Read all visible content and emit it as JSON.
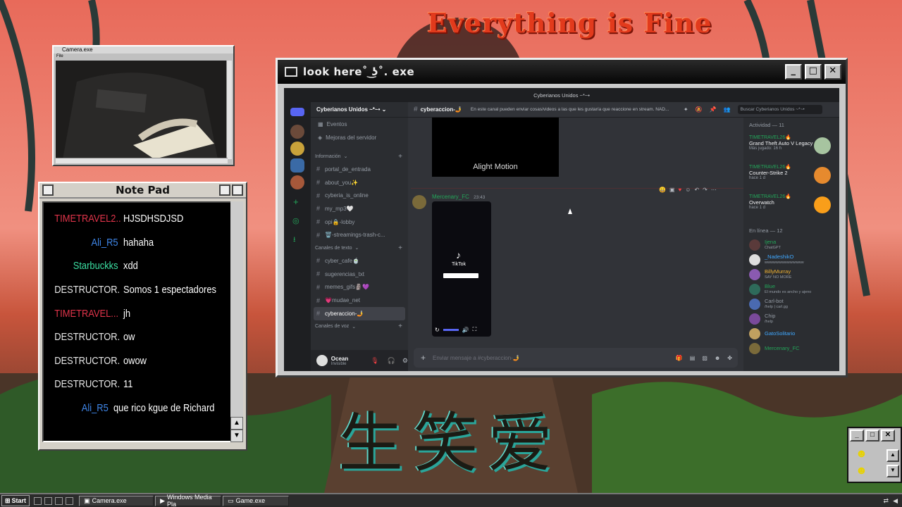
{
  "wallpaper": {
    "headline": "Everything is Fine",
    "kanji": "生笑爱"
  },
  "camera_window": {
    "title": "Camera.exe",
    "menu": "File"
  },
  "notepad": {
    "title": "Note Pad",
    "messages": [
      {
        "user": "TIMETRAVEL2...",
        "text": "HJSDHSDJSD",
        "color": "#e0344a"
      },
      {
        "user": "Ali_R5",
        "text": "hahaha",
        "color": "#3f86e8"
      },
      {
        "user": "Starbuckks",
        "text": "xdd",
        "color": "#3ce0a3"
      },
      {
        "user": "DESTRUCTOR...",
        "text": "Somos 1 espectadores",
        "color": "#e8e8e8"
      },
      {
        "user": "TIMETRAVEL...",
        "text": "jh",
        "color": "#e0344a"
      },
      {
        "user": "DESTRUCTOR...",
        "text": "ow",
        "color": "#e8e8e8"
      },
      {
        "user": "DESTRUCTOR...",
        "text": "owow",
        "color": "#e8e8e8"
      },
      {
        "user": "DESTRUCTOR...",
        "text": "11",
        "color": "#e8e8e8"
      },
      {
        "user": "Ali_R5",
        "text": "que rico kgue de Richard",
        "color": "#3f86e8"
      }
    ]
  },
  "main_window": {
    "title": "look here˚ ͜ʖ˚. exe"
  },
  "discord": {
    "window_title": "Cyberianos Unidos ~*~•",
    "server_name": "Cyberianos Unidos ~*~•",
    "top_items": [
      "Eventos",
      "Mejoras del servidor"
    ],
    "categories": [
      {
        "name": "Información",
        "channels": [
          "portal_de_entrada",
          "about_you✨",
          "cyberia_is_online",
          "my_mp3🤍",
          "opi🔒-lobby",
          "🗑️-streamings-trash-c..."
        ]
      },
      {
        "name": "Canales de texto",
        "channels": [
          "cyber_cafe🍵",
          "sugerencias_txt",
          "memes_gifs🗿💜",
          "💗mudae_net",
          "cyberaccion-🤳"
        ]
      },
      {
        "name": "Canales de voz",
        "channels": []
      }
    ],
    "selected_channel": "cyberaccion-🤳",
    "channel_topic": "En este canal pueden enviar cosas/videos a las que les gustaría que reaccione en stream. NAD...",
    "search_placeholder": "Buscar Cyberianos Unidos ~*~•",
    "message": {
      "author": "Mercenary_FC",
      "time": "23:43"
    },
    "embed_label": "Alight Motion",
    "tiktok_label": "TikTok",
    "input_placeholder": "Enviar mensaje a #cyberaccion-🤳",
    "user": {
      "name": "Ocean",
      "status": "Invisible"
    },
    "activity": {
      "caption": "Actividad — 11",
      "games": [
        {
          "user": "TIMETRAVEL26🔥",
          "game": "Grand Theft Auto V Legacy",
          "status": "Más jugado: 16 h"
        },
        {
          "user": "TIMETRAVEL26🔥",
          "game": "Counter-Strike 2",
          "status": "hace 1 d"
        },
        {
          "user": "TIMETRAVEL26🔥",
          "game": "Overwatch",
          "status": "hace 1 d"
        }
      ],
      "online_caption": "En línea — 12",
      "members": [
        {
          "name": "Ijena",
          "status": "ChatGPT",
          "color": "#23a559"
        },
        {
          "name": "_NadeshikO",
          "status": "wwwwwwwwwwwwww",
          "color": "#3fa8ff"
        },
        {
          "name": "BillyMurray",
          "status": "SAY NO MORE",
          "color": "#f0b232"
        },
        {
          "name": "Blue",
          "status": "El mundo es ancho y ajeno",
          "color": "#23a559"
        },
        {
          "name": "Carl-bot",
          "status": "/help | carl.gg",
          "color": "#949ba4"
        },
        {
          "name": "Chip",
          "status": "/help",
          "color": "#949ba4"
        },
        {
          "name": "GatoSolitario",
          "status": "",
          "color": "#3fa8ff"
        },
        {
          "name": "Mercenary_FC",
          "status": "",
          "color": "#23a559"
        }
      ]
    }
  },
  "taskbar": {
    "start": "Start",
    "buttons": [
      "Camera.exe",
      "Windows Media Pla",
      "Game.exe"
    ]
  }
}
